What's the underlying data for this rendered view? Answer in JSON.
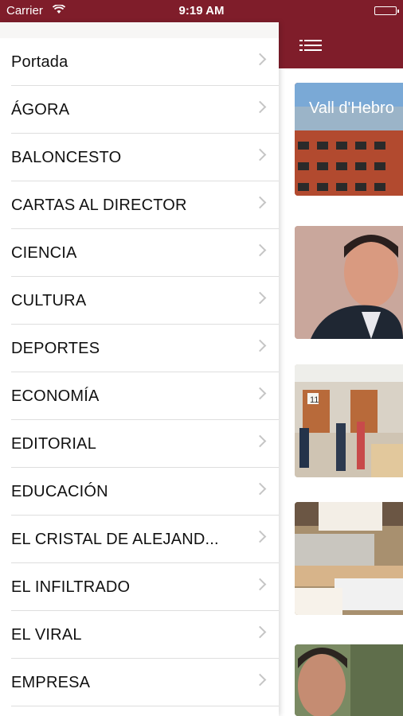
{
  "status_bar": {
    "carrier": "Carrier",
    "wifi_icon": "wifi-icon",
    "time": "9:19 AM",
    "battery_icon": "battery-icon"
  },
  "colors": {
    "brand": "#7f1d2a",
    "separator": "#dedede",
    "chevron": "#c5c5c5"
  },
  "navbar": {
    "menu_icon": "hamburger-menu-icon"
  },
  "menu": {
    "items": [
      {
        "label": "Portada"
      },
      {
        "label": "ÁGORA"
      },
      {
        "label": "BALONCESTO"
      },
      {
        "label": "CARTAS AL DIRECTOR"
      },
      {
        "label": "CIENCIA"
      },
      {
        "label": "CULTURA"
      },
      {
        "label": "DEPORTES"
      },
      {
        "label": "ECONOMÍA"
      },
      {
        "label": "EDITORIAL"
      },
      {
        "label": "EDUCACIÓN"
      },
      {
        "label": "EL CRISTAL DE ALEJAND..."
      },
      {
        "label": "EL INFILTRADO"
      },
      {
        "label": "EL VIRAL"
      },
      {
        "label": "EMPRESA"
      }
    ]
  },
  "thumbnails": [
    {
      "icon": "hospital-building-photo",
      "text": "Vall d'Hebro"
    },
    {
      "icon": "man-portrait-photo"
    },
    {
      "icon": "office-interior-photo",
      "text": "11"
    },
    {
      "icon": "document-folders-photo"
    },
    {
      "icon": "man-outdoors-photo"
    }
  ]
}
